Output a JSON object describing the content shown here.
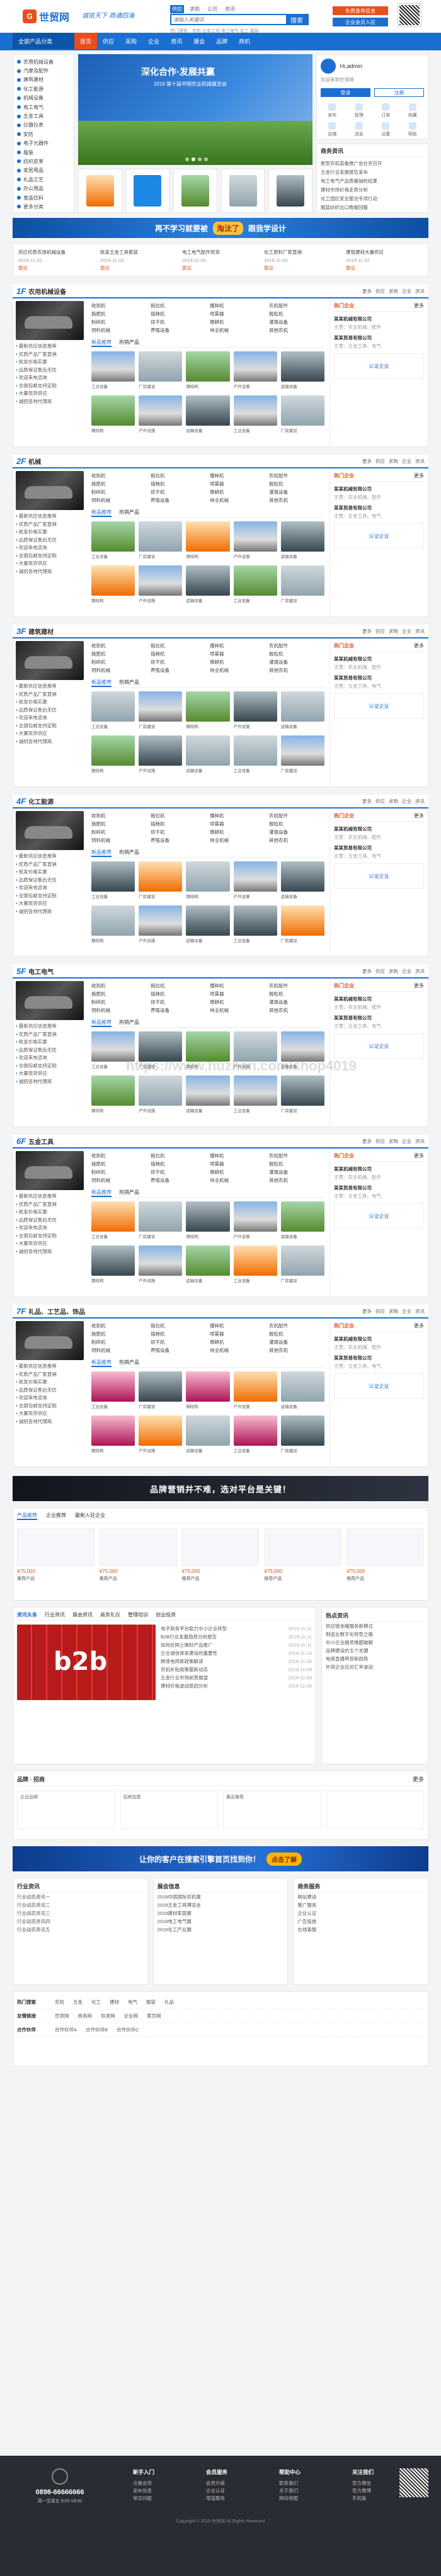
{
  "site": {
    "logo_letter": "G",
    "logo_text": "世贸网",
    "slogan": "诚信天下 商通四海"
  },
  "search": {
    "tabs": [
      "供应",
      "求购",
      "公司",
      "资讯"
    ],
    "placeholder": "请输入关键词",
    "button": "搜索",
    "hotwords": "热门搜索：农机 五金工具 电工电气 化工 服装"
  },
  "top_buttons": [
    {
      "label": "免费发布信息",
      "color": "#e84f1d"
    },
    {
      "label": "企业会员入驻",
      "color": "#1b6fd0"
    }
  ],
  "nav": {
    "items": [
      "全部产品分类",
      "首页",
      "供应",
      "采购",
      "企业",
      "资讯",
      "展会",
      "品牌",
      "商机"
    ]
  },
  "categories": [
    "农用机械设备",
    "汽摩及配件",
    "建筑建材",
    "化工能源",
    "机械设备",
    "电工电气",
    "五金工具",
    "仪器仪表",
    "安防",
    "电子元器件",
    "服装",
    "纺织皮革",
    "家居用品",
    "礼品工艺",
    "办公用品",
    "食品饮料",
    "更多分类"
  ],
  "banner": {
    "title": "深化合作·发展共赢",
    "subtitle": "2019 第十届中国农业机械展览会"
  },
  "user": {
    "name": "Hi,admin",
    "greeting": "欢迎来到世贸网",
    "login": "登录",
    "register": "注册",
    "icons": [
      "发布",
      "管理",
      "订单",
      "收藏",
      "店铺",
      "消息",
      "设置",
      "帮助"
    ]
  },
  "news_box": {
    "title": "商务资讯",
    "items": [
      "新型农机装备推广会在京召开",
      "五金行业发展报告发布",
      "电工电气产品质量抽检结果",
      "建材市场价格走势分析",
      "化工园区安全整治专项行动",
      "服装纺织出口数据回暖"
    ]
  },
  "ad1": {
    "text": "再不学习就要被",
    "highlight": "淘汰了",
    "tail": "跟我学设计"
  },
  "supply": [
    {
      "title": "供应优质农用机械设备",
      "meta": "2019-11-02",
      "price": "面议"
    },
    {
      "title": "批发五金工具套装",
      "meta": "2019-11-02",
      "price": "面议"
    },
    {
      "title": "电工电气配件现货",
      "meta": "2019-11-02",
      "price": "面议"
    },
    {
      "title": "化工原料厂家直销",
      "meta": "2019-11-02",
      "price": "面议"
    },
    {
      "title": "建筑建材大量供应",
      "meta": "2019-11-02",
      "price": "面议"
    }
  ],
  "floors": [
    {
      "num": "1F",
      "title": "农用机械设备",
      "img": [
        "img-a",
        "img-b",
        "img-c",
        "img-a",
        "img-e"
      ]
    },
    {
      "num": "2F",
      "title": "机械",
      "img": [
        "img-c",
        "img-b",
        "img-d",
        "img-a",
        "img-e"
      ]
    },
    {
      "num": "3F",
      "title": "建筑建材",
      "img": [
        "img-b",
        "img-a",
        "img-c",
        "img-e",
        "img-b"
      ]
    },
    {
      "num": "4F",
      "title": "化工能源",
      "img": [
        "img-e",
        "img-d",
        "img-b",
        "img-a",
        "img-e"
      ]
    },
    {
      "num": "5F",
      "title": "电工电气",
      "img": [
        "img-a",
        "img-e",
        "img-c",
        "img-b",
        "img-a"
      ]
    },
    {
      "num": "6F",
      "title": "五金工具",
      "img": [
        "img-d",
        "img-b",
        "img-e",
        "img-a",
        "img-c"
      ]
    },
    {
      "num": "7F",
      "title": "礼品、工艺品、饰品",
      "img": [
        "img-f",
        "img-e",
        "img-f",
        "img-d",
        "img-b"
      ]
    }
  ],
  "floor_common": {
    "tabs": [
      "更多",
      "供应",
      "求购",
      "企业",
      "资讯"
    ],
    "cats": [
      "收割机",
      "拖拉机",
      "播种机",
      "农机配件",
      "施肥机",
      "插秧机",
      "喷雾器",
      "脱粒机",
      "粉碎机",
      "烘干机",
      "微耕机",
      "灌溉设备",
      "饲料机械",
      "养殖设备",
      "林业机械",
      "其他农机"
    ],
    "left_items": [
      "最新供应信息推荐",
      "优质产品厂家直销",
      "批发价格实惠",
      "品质保证售后无忧",
      "欢迎来电咨询",
      "全国包邮支持定制",
      "大量现货供应",
      "诚招各地代理商"
    ],
    "prod_tabs": [
      "新品推荐",
      "热销产品"
    ],
    "prod_caps": [
      "工业设备",
      "厂房建设",
      "钢结构",
      "户外设施",
      "运输设备"
    ],
    "right_head": "热门企业",
    "right_more": "更多",
    "companies": [
      {
        "name": "某某机械有限公司",
        "desc": "主营：农业机械、配件"
      },
      {
        "name": "某某贸易有限公司",
        "desc": "主营：五金工具、电气"
      }
    ],
    "badge": "认证企业"
  },
  "brand_banner": "品牌营销并不难，选对平台是关键！",
  "recommend": {
    "tabs": [
      "产品推荐",
      "企业推荐",
      "最新入驻企业"
    ],
    "items": [
      {
        "price": "¥75,000",
        "title": "推荐产品"
      },
      {
        "price": "¥75,000",
        "title": "推荐产品"
      },
      {
        "price": "¥75,000",
        "title": "推荐产品"
      },
      {
        "price": "¥75,000",
        "title": "推荐产品"
      },
      {
        "price": "¥75,000",
        "title": "推荐产品"
      }
    ]
  },
  "news_section": {
    "tabs": [
      "资讯头条",
      "行业资讯",
      "展会资讯",
      "商务礼仪",
      "管理培训",
      "创业投资"
    ],
    "badge_text": "b2b",
    "items": [
      {
        "t": "电子商务平台助力中小企业转型",
        "d": "2019-11-11"
      },
      {
        "t": "B2B行业发展趋势分析报告",
        "d": "2019-11-11"
      },
      {
        "t": "如何在网上做好产品推广",
        "d": "2019-11-11"
      },
      {
        "t": "企业诚信体系建设的重要性",
        "d": "2019-11-10"
      },
      {
        "t": "跨境电商新政策解读",
        "d": "2019-11-10"
      },
      {
        "t": "农机补贴政策最新动态",
        "d": "2019-11-09"
      },
      {
        "t": "五金行业市场前景展望",
        "d": "2019-11-09"
      },
      {
        "t": "建材价格波动原因分析",
        "d": "2019-11-08"
      }
    ],
    "side_title": "热点资讯",
    "side_items": [
      "供应链金融服务新模式",
      "制造业数字化转型之路",
      "中小企业融资难题破解",
      "品牌建设的五个关键",
      "电商直播带货新趋势",
      "外贸企业应对汇率波动"
    ]
  },
  "mini_sec": {
    "title": "品牌 · 招商",
    "more": "更多",
    "tabs": [
      "企业品牌",
      "招商加盟",
      "展会推荐"
    ]
  },
  "ad2": {
    "text": "让你的客户在搜索引擎首页找到你！",
    "button": "点击了解"
  },
  "bottom_lists": [
    {
      "title": "行业资讯",
      "items": [
        "行业动态资讯一",
        "行业动态资讯二",
        "行业动态资讯三",
        "行业动态资讯四",
        "行业动态资讯五"
      ]
    },
    {
      "title": "展会信息",
      "items": [
        "2019中国国际农机展",
        "2019五金工具博览会",
        "2019建材家居展",
        "2019电工电气展",
        "2019化工产业展"
      ]
    },
    {
      "title": "商务服务",
      "items": [
        "网站建设",
        "推广服务",
        "企业认证",
        "广告投放",
        "在线客服"
      ]
    }
  ],
  "links": [
    {
      "label": "热门搜索",
      "items": [
        "农机",
        "五金",
        "化工",
        "建材",
        "电气",
        "服装",
        "礼品"
      ]
    },
    {
      "label": "友情链接",
      "items": [
        "世贸网",
        "商务网",
        "供求网",
        "企业网",
        "黄页网"
      ]
    },
    {
      "label": "合作伙伴",
      "items": [
        "合作伙伴A",
        "合作伙伴B",
        "合作伙伴C"
      ]
    }
  ],
  "footer": {
    "phone": "0898-66666666",
    "phone_sub": "周一至周五 9:00-18:00",
    "cols": [
      {
        "title": "新手入门",
        "items": [
          "注册会员",
          "发布信息",
          "常见问题"
        ]
      },
      {
        "title": "会员服务",
        "items": [
          "会员升级",
          "企业认证",
          "增值服务"
        ]
      },
      {
        "title": "帮助中心",
        "items": [
          "联系我们",
          "关于我们",
          "网站地图"
        ]
      },
      {
        "title": "关注我们",
        "items": [
          "官方微信",
          "官方微博",
          "手机版"
        ]
      }
    ],
    "copyright": "Copyright © 2019 世贸网 All Rights Reserved"
  },
  "watermark": "https://www.huzhan.com/shop4019"
}
